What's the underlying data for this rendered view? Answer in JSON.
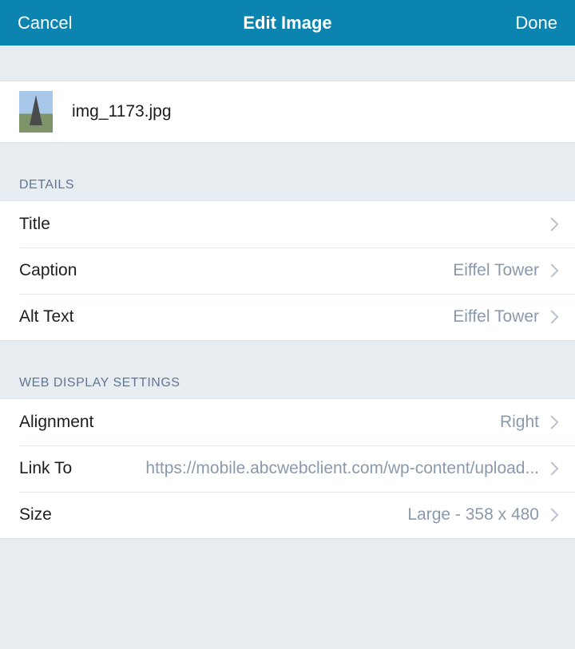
{
  "navbar": {
    "cancel": "Cancel",
    "title": "Edit Image",
    "done": "Done"
  },
  "file": {
    "name": "img_1173.jpg"
  },
  "sections": {
    "details": {
      "header": "DETAILS",
      "title": {
        "label": "Title",
        "value": ""
      },
      "caption": {
        "label": "Caption",
        "value": "Eiffel Tower"
      },
      "altText": {
        "label": "Alt Text",
        "value": "Eiffel Tower"
      }
    },
    "web": {
      "header": "WEB DISPLAY SETTINGS",
      "alignment": {
        "label": "Alignment",
        "value": "Right"
      },
      "linkTo": {
        "label": "Link To",
        "value": "https://mobile.abcwebclient.com/wp-content/upload..."
      },
      "size": {
        "label": "Size",
        "value": "Large - 358 x 480"
      }
    }
  }
}
